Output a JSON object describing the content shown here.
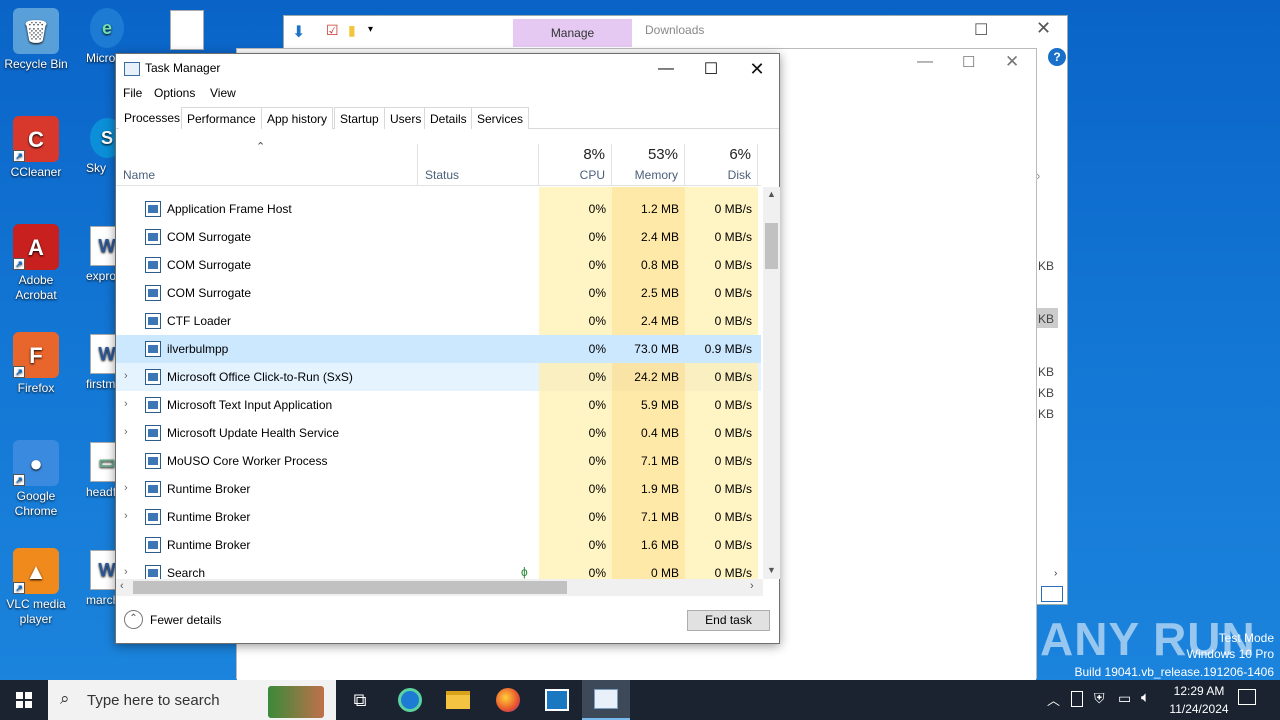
{
  "desktop": {
    "icons_left": [
      {
        "label": "Recycle Bin",
        "color": "#5aa0d8",
        "glyph": "🗑"
      },
      {
        "label": "CCleaner",
        "color": "#d8382c",
        "glyph": "C"
      },
      {
        "label": "Adobe Acrobat",
        "color": "#c8201e",
        "glyph": "A"
      },
      {
        "label": "Firefox",
        "color": "#e8652c",
        "glyph": "F"
      },
      {
        "label": "Google Chrome",
        "color": "#3a8adf",
        "glyph": "●"
      },
      {
        "label": "VLC media player",
        "color": "#f08a1c",
        "glyph": "▲"
      }
    ],
    "icons_right": [
      "Micro Ed",
      "Sky",
      "exprob",
      "firstma",
      "headfo",
      "marcha"
    ],
    "watermark": {
      "brand": "ANY RUN",
      "line1": "Test Mode",
      "line2": "Windows 10 Pro",
      "line3": "Build 19041.vb_release.191206-1406"
    }
  },
  "explorer": {
    "tab_manage": "Manage",
    "tab_downloads": "Downloads",
    "kb": [
      "KB",
      "KB",
      "KB",
      "KB",
      "KB"
    ]
  },
  "task_manager": {
    "title": "Task Manager",
    "menu": [
      "File",
      "Options",
      "View"
    ],
    "tabs": [
      "Processes",
      "Performance",
      "App history",
      "Startup",
      "Users",
      "Details",
      "Services"
    ],
    "columns": {
      "name": "Name",
      "status": "Status",
      "cpu": {
        "pct": "8%",
        "label": "CPU"
      },
      "memory": {
        "pct": "53%",
        "label": "Memory"
      },
      "disk": {
        "pct": "6%",
        "label": "Disk"
      }
    },
    "processes": [
      {
        "name": "Application Frame Host",
        "cpu": "0%",
        "memory": "1.2 MB",
        "disk": "0 MB/s",
        "expandable": false
      },
      {
        "name": "COM Surrogate",
        "cpu": "0%",
        "memory": "2.4 MB",
        "disk": "0 MB/s",
        "expandable": false
      },
      {
        "name": "COM Surrogate",
        "cpu": "0%",
        "memory": "0.8 MB",
        "disk": "0 MB/s",
        "expandable": false
      },
      {
        "name": "COM Surrogate",
        "cpu": "0%",
        "memory": "2.5 MB",
        "disk": "0 MB/s",
        "expandable": false
      },
      {
        "name": "CTF Loader",
        "cpu": "0%",
        "memory": "2.4 MB",
        "disk": "0 MB/s",
        "expandable": false
      },
      {
        "name": "ilverbulmpp",
        "cpu": "0%",
        "memory": "73.0 MB",
        "disk": "0.9 MB/s",
        "expandable": false,
        "selected": true
      },
      {
        "name": "Microsoft Office Click-to-Run (SxS)",
        "cpu": "0%",
        "memory": "24.2 MB",
        "disk": "0 MB/s",
        "expandable": true,
        "hover": true
      },
      {
        "name": "Microsoft Text Input Application",
        "cpu": "0%",
        "memory": "5.9 MB",
        "disk": "0 MB/s",
        "expandable": true
      },
      {
        "name": "Microsoft Update Health Service",
        "cpu": "0%",
        "memory": "0.4 MB",
        "disk": "0 MB/s",
        "expandable": true
      },
      {
        "name": "MoUSO Core Worker Process",
        "cpu": "0%",
        "memory": "7.1 MB",
        "disk": "0 MB/s",
        "expandable": false
      },
      {
        "name": "Runtime Broker",
        "cpu": "0%",
        "memory": "1.9 MB",
        "disk": "0 MB/s",
        "expandable": true
      },
      {
        "name": "Runtime Broker",
        "cpu": "0%",
        "memory": "7.1 MB",
        "disk": "0 MB/s",
        "expandable": true
      },
      {
        "name": "Runtime Broker",
        "cpu": "0%",
        "memory": "1.6 MB",
        "disk": "0 MB/s",
        "expandable": false
      },
      {
        "name": "Search",
        "cpu": "0%",
        "memory": "0 MB",
        "disk": "0 MB/s",
        "expandable": true
      }
    ],
    "fewer_details": "Fewer details",
    "end_task": "End task"
  },
  "taskbar": {
    "search_placeholder": "Type here to search",
    "time": "12:29 AM",
    "date": "11/24/2024"
  }
}
